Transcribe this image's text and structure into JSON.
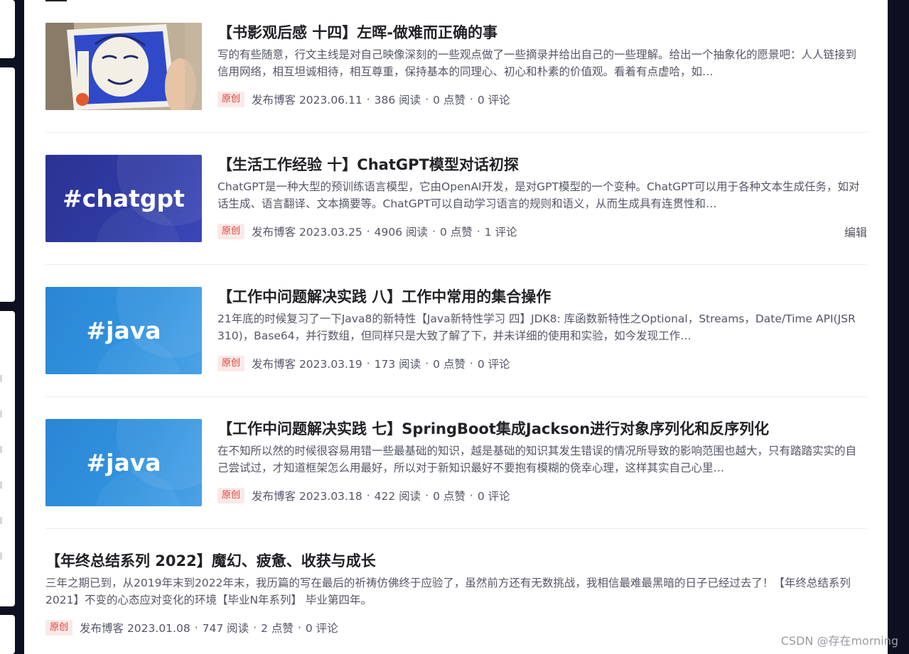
{
  "articles": [
    {
      "thumb": {
        "type": "photo",
        "text": ""
      },
      "title": "【书影观后感 十四】左晖-做难而正确的事",
      "desc": "写的有些随意，行文主线是对自己映像深刻的一些观点做了一些摘录并给出自己的一些理解。给出一个抽象化的愿景吧：人人链接到信用网络，相互坦诚相待，相互尊重，保持基本的同理心、初心和朴素的价值观。看着有点虚哈，如…",
      "badge": "原创",
      "published": "发布博客 2023.06.11",
      "reads": "386 阅读",
      "likes": "0 点赞",
      "comments": "0 评论"
    },
    {
      "thumb": {
        "type": "chatgpt",
        "text": "#chatgpt"
      },
      "title": "【生活工作经验 十】ChatGPT模型对话初探",
      "desc": "ChatGPT是一种大型的预训练语言模型，它由OpenAI开发，是对GPT模型的一个变种。ChatGPT可以用于各种文本生成任务，如对话生成、语言翻译、文本摘要等。ChatGPT可以自动学习语言的规则和语义，从而生成具有连贯性和…",
      "badge": "原创",
      "published": "发布博客 2023.03.25",
      "reads": "4906 阅读",
      "likes": "0 点赞",
      "comments": "1 评论",
      "edit": "编辑"
    },
    {
      "thumb": {
        "type": "java",
        "text": "#java"
      },
      "title": "【工作中问题解决实践 八】工作中常用的集合操作",
      "desc": "21年底的时候复习了一下Java8的新特性【Java新特性学习 四】JDK8: 库函数新特性之Optional，Streams，Date/Time API(JSR 310)，Base64，并行数组，但同样只是大致了解了下，并未详细的使用和实验，如今发现工作…",
      "badge": "原创",
      "published": "发布博客 2023.03.19",
      "reads": "173 阅读",
      "likes": "0 点赞",
      "comments": "0 评论"
    },
    {
      "thumb": {
        "type": "java",
        "text": "#java"
      },
      "title": "【工作中问题解决实践 七】SpringBoot集成Jackson进行对象序列化和反序列化",
      "desc": "在不知所以然的时候很容易用错一些最基础的知识，越是基础的知识其发生错误的情况所导致的影响范围也越大，只有踏踏实实的自己尝试过，才知道框架怎么用最好，所以对于新知识最好不要抱有模糊的侥幸心理，这样其实自己心里…",
      "badge": "原创",
      "published": "发布博客 2023.03.18",
      "reads": "422 阅读",
      "likes": "0 点赞",
      "comments": "0 评论"
    },
    {
      "thumb": null,
      "title": "【年终总结系列 2022】魔幻、疲惫、收获与成长",
      "desc": "三年之期已到，从2019年末到2022年末，我历篇的写在最后的祈祷仿佛终于应验了，虽然前方还有无数挑战，我相信最难最黑暗的日子已经过去了！【年终总结系列 2021】不变的心态应对变化的环境【毕业N年系列】 毕业第四年。",
      "badge": "原创",
      "published": "发布博客 2023.01.08",
      "reads": "747 阅读",
      "likes": "2 点赞",
      "comments": "0 评论"
    }
  ],
  "separator": "·",
  "watermark": "CSDN @存在morning"
}
